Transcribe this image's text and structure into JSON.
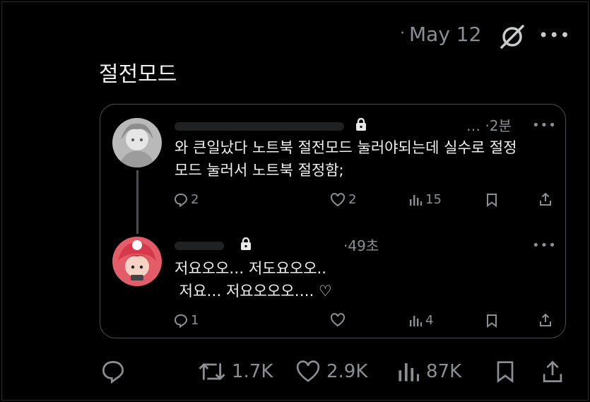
{
  "header": {
    "date": "May 12",
    "separator": "·"
  },
  "post": {
    "text": "절전모드"
  },
  "quoted_thread": [
    {
      "time": "2분",
      "time_prefix": "… ·",
      "text": "와 큰일났다 노트북 절전모드 눌러야되는데 실수로 절정\n모드 눌러서 노트북 절정함;",
      "replies": "2",
      "likes": "2",
      "views": "15"
    },
    {
      "time": "49초",
      "time_prefix": "·",
      "text": "저요오오… 저도요오오..\n 저요… 저요오오오…. ♡",
      "replies": "1",
      "likes": "",
      "views": "4"
    }
  ],
  "actions": {
    "reposts": "1.7K",
    "likes": "2.9K",
    "views": "87K"
  },
  "colors": {
    "background": "#000000",
    "text": "#f1f1f1",
    "muted": "#8b8f94",
    "border": "#4a4d51"
  }
}
